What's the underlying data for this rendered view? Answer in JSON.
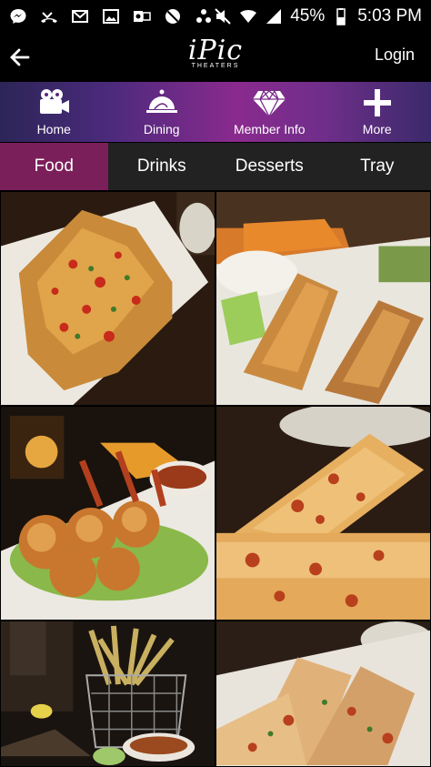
{
  "status_bar": {
    "battery": "45%",
    "time": "5:03 PM",
    "left_icons": [
      "messenger-icon",
      "missed-call-icon",
      "gmail-icon",
      "image-icon",
      "outlook-icon",
      "blocked-icon",
      "dots-icon"
    ],
    "right_icons": [
      "mute-icon",
      "wifi-icon",
      "signal-icon",
      "battery-icon"
    ]
  },
  "header": {
    "logo_main": "iPic",
    "logo_sub": "THEATERS",
    "login_label": "Login"
  },
  "nav": {
    "items": [
      {
        "label": "Home",
        "icon": "camera-icon"
      },
      {
        "label": "Dining",
        "icon": "cloche-icon"
      },
      {
        "label": "Member Info",
        "icon": "diamond-icon"
      },
      {
        "label": "More",
        "icon": "plus-icon"
      }
    ]
  },
  "tabs": {
    "items": [
      "Food",
      "Drinks",
      "Desserts",
      "Tray"
    ],
    "active": "Food"
  },
  "grid": {
    "tiles": [
      {
        "subject": "quesadilla-with-pico"
      },
      {
        "subject": "egg-rolls-with-dip"
      },
      {
        "subject": "coconut-shrimp"
      },
      {
        "subject": "flatbread-melt"
      },
      {
        "subject": "fries-basket-with-sauce"
      },
      {
        "subject": "quesadilla-wedges"
      }
    ]
  },
  "colors": {
    "nav_gradient_start": "#2c2557",
    "nav_gradient_mid": "#8a2a8e",
    "tab_active": "#7b1f5a",
    "tab_bg": "#222222"
  }
}
